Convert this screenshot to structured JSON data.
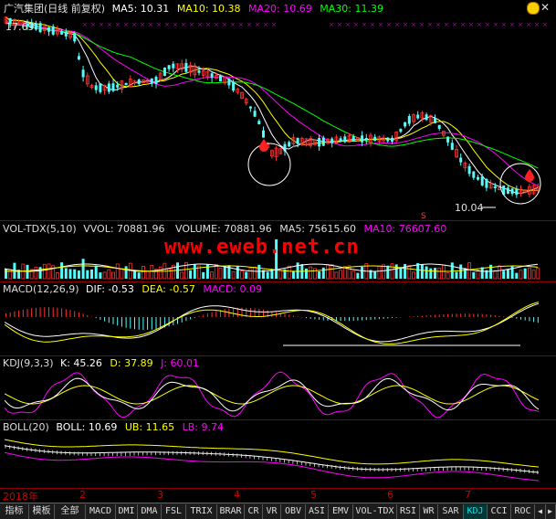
{
  "main": {
    "title": "广汽集团(日线 前复权)",
    "ma5": "MA5: 10.31",
    "ma10": "MA10: 10.38",
    "ma20": "MA20: 10.69",
    "ma30": "MA30: 11.39",
    "high_label": "17.69",
    "low_label": "10.04",
    "marker_s": "S"
  },
  "volume": {
    "name": "VOL-TDX(5,10)",
    "vvol": "VVOL: 70881.96",
    "volume": "VOLUME: 70881.96",
    "ma5": "MA5: 75615.60",
    "ma10": "MA10: 76607.60"
  },
  "macd": {
    "name": "MACD(12,26,9)",
    "dif": "DIF: -0.53",
    "dea": "DEA: -0.57",
    "macd": "MACD: 0.09"
  },
  "kdj": {
    "name": "KDJ(9,3,3)",
    "k": "K: 45.26",
    "d": "D: 37.89",
    "j": "J: 60.01"
  },
  "boll": {
    "name": "BOLL(20)",
    "boll": "BOLL: 10.69",
    "ub": "UB: 11.65",
    "lb": "LB: 9.74"
  },
  "watermark": "www.eweb.net.cn",
  "time_axis": [
    "2018年",
    "2",
    "3",
    "4",
    "5",
    "6",
    "7"
  ],
  "tabs": [
    "指标",
    "模板",
    "全部",
    "MACD",
    "DMI",
    "DMA",
    "FSL",
    "TRIX",
    "BRAR",
    "CR",
    "VR",
    "OBV",
    "ASI",
    "EMV",
    "VOL-TDX",
    "RSI",
    "WR",
    "SAR",
    "KDJ",
    "CCI",
    "ROC"
  ],
  "active_tab": "KDJ",
  "colors": {
    "up": "#ff3232",
    "down": "#54fcfc",
    "ma5": "#ffffff",
    "ma10": "#ffff00",
    "ma20": "#ff00ff",
    "ma30": "#00ff00",
    "separator": "#8b0000",
    "watermark": "#ff0000"
  }
}
